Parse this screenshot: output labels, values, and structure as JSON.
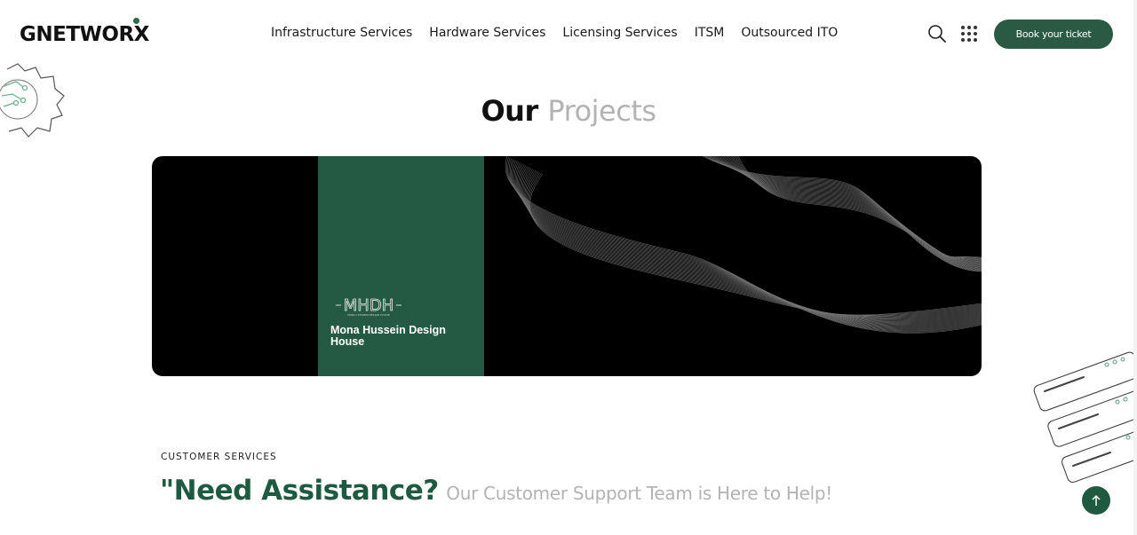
{
  "header": {
    "logo_text": "GNETWORX",
    "nav": [
      {
        "label": "Infrastructure Services"
      },
      {
        "label": "Hardware Services"
      },
      {
        "label": "Licensing Services"
      },
      {
        "label": "ITSM"
      },
      {
        "label": "Outsourced ITO"
      }
    ],
    "search_icon": "search-icon",
    "apps_icon": "grid-dots-icon",
    "book_button": "Book your ticket"
  },
  "projects": {
    "title_part1": "Our",
    "title_part2": "Projects",
    "card": {
      "logo_text": "MHDH",
      "logo_subtext": "MONA HUSSEIN DESIGN HOUSE",
      "name": "Mona Hussein Design House"
    }
  },
  "customer_services": {
    "label": "CUSTOMER SERVICES",
    "heading_main": "\"Need Assistance?",
    "heading_sub": "Our Customer Support Team is Here to Help!"
  },
  "scroll_top_icon": "arrow-up-icon",
  "colors": {
    "brand_green": "#2b5a44",
    "card_green": "#245a43",
    "muted_gray": "#b3b3b3"
  }
}
